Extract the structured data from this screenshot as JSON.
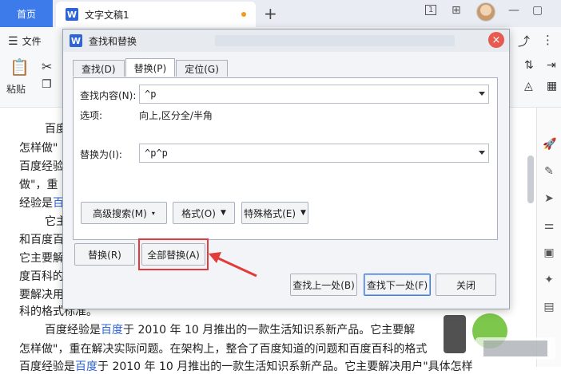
{
  "tabbar": {
    "home_label": "首页",
    "doc_title": "文字文稿1",
    "new_tab": "+",
    "ctl_view": "1",
    "ctl_grid": "⊞",
    "ctl_min": "—",
    "ctl_restore": "▢"
  },
  "ribbon": {
    "menu_label": "文件",
    "paste_label": "粘贴"
  },
  "document": {
    "lines": [
      {
        "a": "百度",
        "b": "",
        "c": ""
      },
      {
        "a": "怎样做\"",
        "b": "",
        "c": ""
      },
      {
        "a": "百度经验",
        "b": "",
        "c": ""
      },
      {
        "a": "做\"，重",
        "b": "",
        "c": ""
      },
      {
        "a": "经验是",
        "b": "百",
        "c": ""
      },
      {
        "a": "它主",
        "b": "",
        "c": ""
      },
      {
        "a": "和百度百",
        "b": "",
        "c": ""
      },
      {
        "a": "它主要解",
        "b": "",
        "c": ""
      },
      {
        "a": "度百科的",
        "b": "",
        "c": ""
      },
      {
        "a": "要解决用",
        "b": "",
        "c": ""
      },
      {
        "a": "科的格式标准。",
        "b": "",
        "c": ""
      },
      {
        "a": "百度经验是",
        "b": "百度",
        "c": "于 2010 年 10 月推出的一款生活知识系新产品。它主要解"
      },
      {
        "a": "怎样做\"，重在解决实际问题。在架构上，整合了百度知道的问题和百度百科的格式",
        "b": "",
        "c": ""
      },
      {
        "a": "百度经验是",
        "b": "百度",
        "c": "于 2010 年 10 月推出的一款生活知识系新产品。它主要解决用户\"具体怎样"
      }
    ]
  },
  "dialog": {
    "title": "查找和替换",
    "close_label": "×",
    "tabs": [
      {
        "label": "查找(D)",
        "active": false
      },
      {
        "label": "替换(P)",
        "active": true
      },
      {
        "label": "定位(G)",
        "active": false
      }
    ],
    "find_label": "查找内容(N):",
    "find_value": "^p",
    "options_label": "选项:",
    "options_value": "向上,区分全/半角",
    "replace_label": "替换为(I):",
    "replace_value": "^p^p",
    "advanced_search": "高级搜索(M)",
    "format": "格式(O)",
    "special_format": "特殊格式(E)",
    "replace_btn": "替换(R)",
    "replace_all_btn": "全部替换(A)",
    "find_prev_btn": "查找上一处(B)",
    "find_next_btn": "查找下一处(F)",
    "close_btn": "关闭"
  },
  "colors": {
    "accent": "#3e7bea",
    "highlight_red": "#e13b3b",
    "close_red": "#e65a4f"
  }
}
